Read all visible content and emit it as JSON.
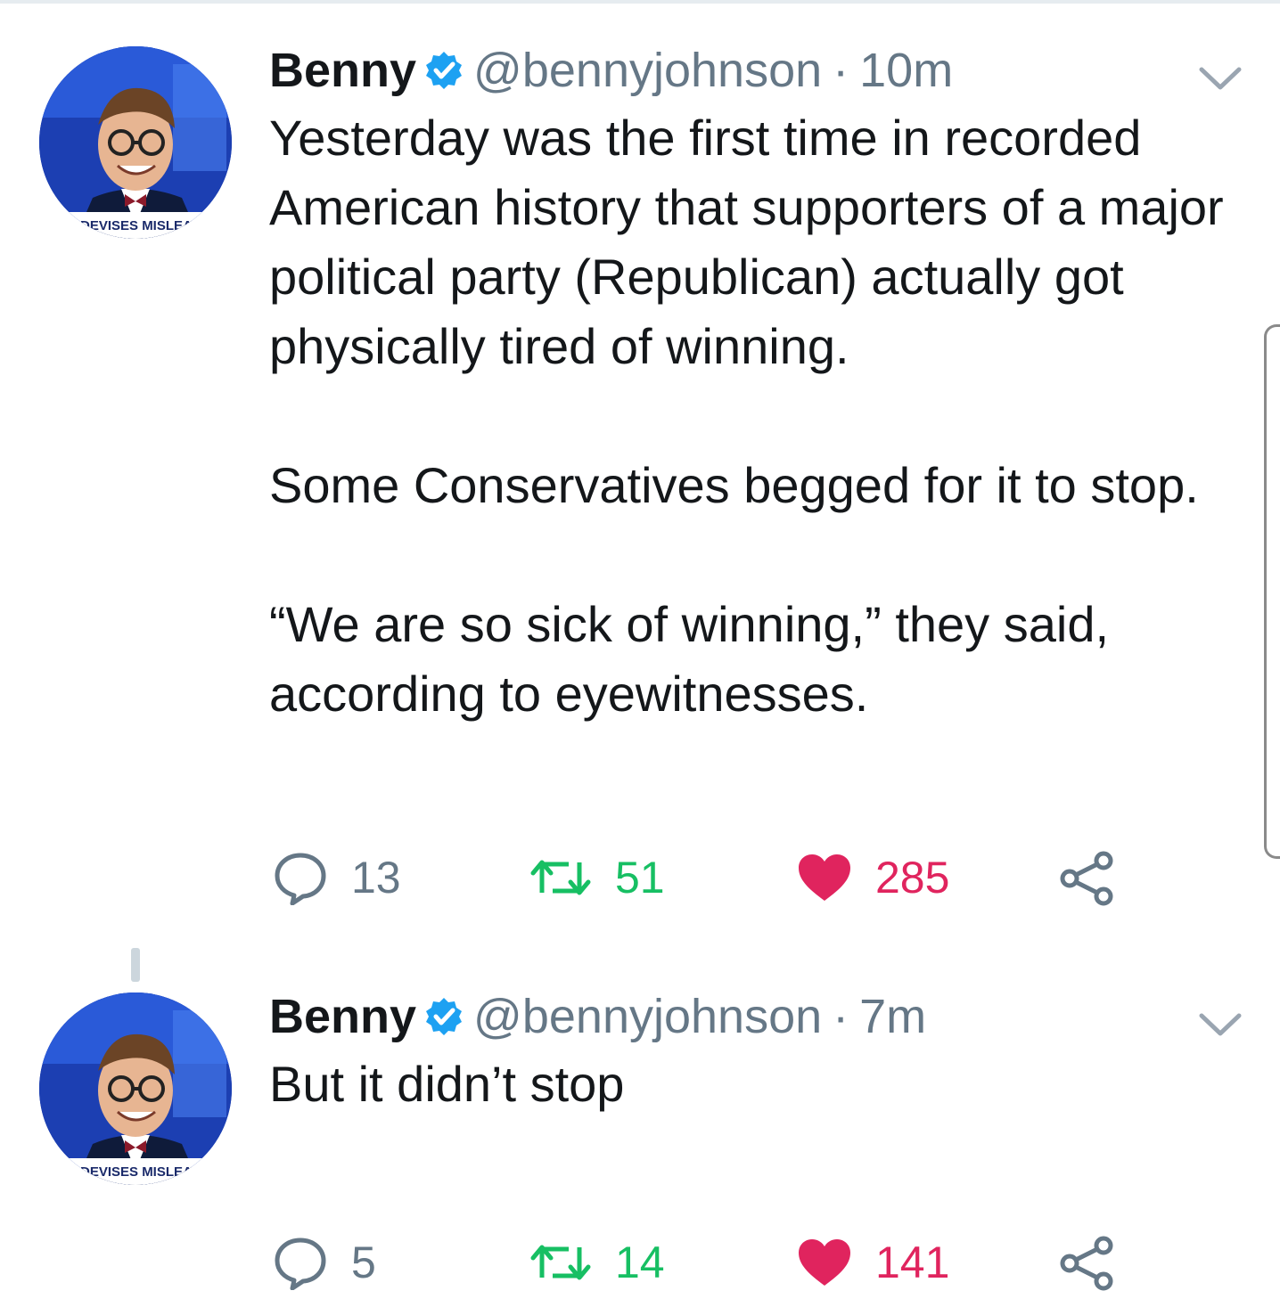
{
  "tweets": [
    {
      "author_name": "Benny",
      "handle": "@bennyjohnson",
      "separator": "·",
      "time": "10m",
      "paragraphs": [
        "Yesterday was the first time in recorded American history that supporters of a major political party (Republican) actually got physically tired of winning.",
        "Some Conservatives begged for it to stop.",
        "“We are so sick of winning,” they said, according to eyewitnesses."
      ],
      "reply_count": "13",
      "retweet_count": "51",
      "like_count": "285",
      "liked": true,
      "avatar_caption": "DEVISES MISLEADING"
    },
    {
      "author_name": "Benny",
      "handle": "@bennyjohnson",
      "separator": "·",
      "time": "7m",
      "paragraphs": [
        "But it didn’t stop"
      ],
      "reply_count": "5",
      "retweet_count": "14",
      "like_count": "141",
      "liked": true,
      "avatar_caption": "DEVISES MISLEADING"
    }
  ],
  "icons": {
    "verified": "verified-badge-icon",
    "reply": "reply-bubble-icon",
    "retweet": "retweet-arrows-icon",
    "like": "heart-icon",
    "share": "share-nodes-icon",
    "menu": "chevron-down-icon"
  },
  "colors": {
    "verified_blue": "#1da1f2",
    "retweet_green": "#17bf63",
    "like_red": "#e0245e",
    "secondary_gray": "#657786",
    "text": "#14171a"
  }
}
